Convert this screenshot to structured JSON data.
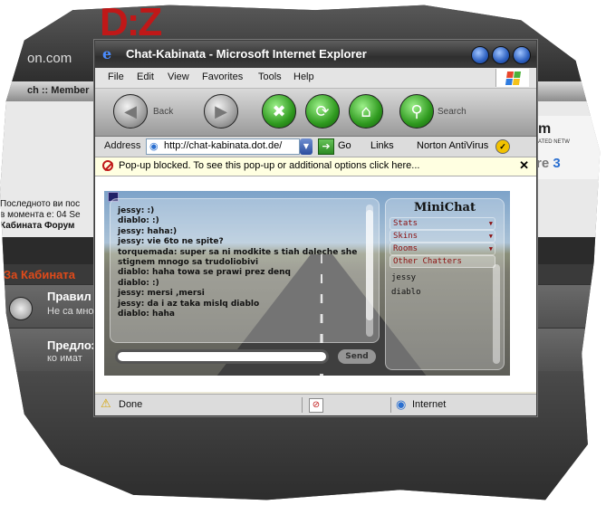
{
  "background_page": {
    "logo": "D:Z",
    "url_fragment": "on.com",
    "nav_fragment": "ch :: Member",
    "info_lines": [
      "Последното ви пос",
      "в момента е: 04 Se"
    ],
    "info_bold": "Кабината Форум",
    "section_title": "За Кабината",
    "rows": [
      {
        "title": "Правил",
        "subtitle": "Не са мно"
      },
      {
        "title": "Предлоз",
        "subtitle": "ко имат"
      }
    ],
    "right_badge": {
      "m": "m",
      "small": "ATED NETW",
      "r": "re",
      "num": "3"
    }
  },
  "window": {
    "title": "Chat-Kabinata - Microsoft Internet Explorer",
    "menu": [
      "File",
      "Edit",
      "View",
      "Favorites",
      "Tools",
      "Help"
    ],
    "toolbar": {
      "back_label": "Back",
      "search_label": "Search"
    },
    "address": {
      "label": "Address",
      "url": "http://chat-kabinata.dot.de/",
      "go_label": "Go",
      "links_label": "Links",
      "norton_label": "Norton AntiVirus"
    },
    "popup_message": "Pop-up blocked. To see this pop-up or additional options click here...",
    "status": {
      "text": "Done",
      "zone": "Internet"
    }
  },
  "chat": {
    "messages": [
      "jessy: :)",
      "diablo: :)",
      "jessy: haha:)",
      "jessy: vie 6to ne spite?",
      "torquemada: super sa ni modkite s tiah daleche she stignem mnogo sa trudoliobivi",
      "diablo: haha towa se prawi prez denq",
      "diablo: :)",
      "jessy: mersi ,mersi",
      "jessy: da i az taka mislq diablo",
      "diablo: haha"
    ],
    "input_value": "",
    "send_label": "Send",
    "sidebar": {
      "title": "MiniChat",
      "menu": [
        "Stats",
        "Skins",
        "Rooms",
        "Other Chatters"
      ],
      "users": [
        "jessy",
        "diablo"
      ]
    }
  },
  "colors": {
    "accent_red": "#8b1010",
    "popup_bg": "#ffffe1"
  }
}
